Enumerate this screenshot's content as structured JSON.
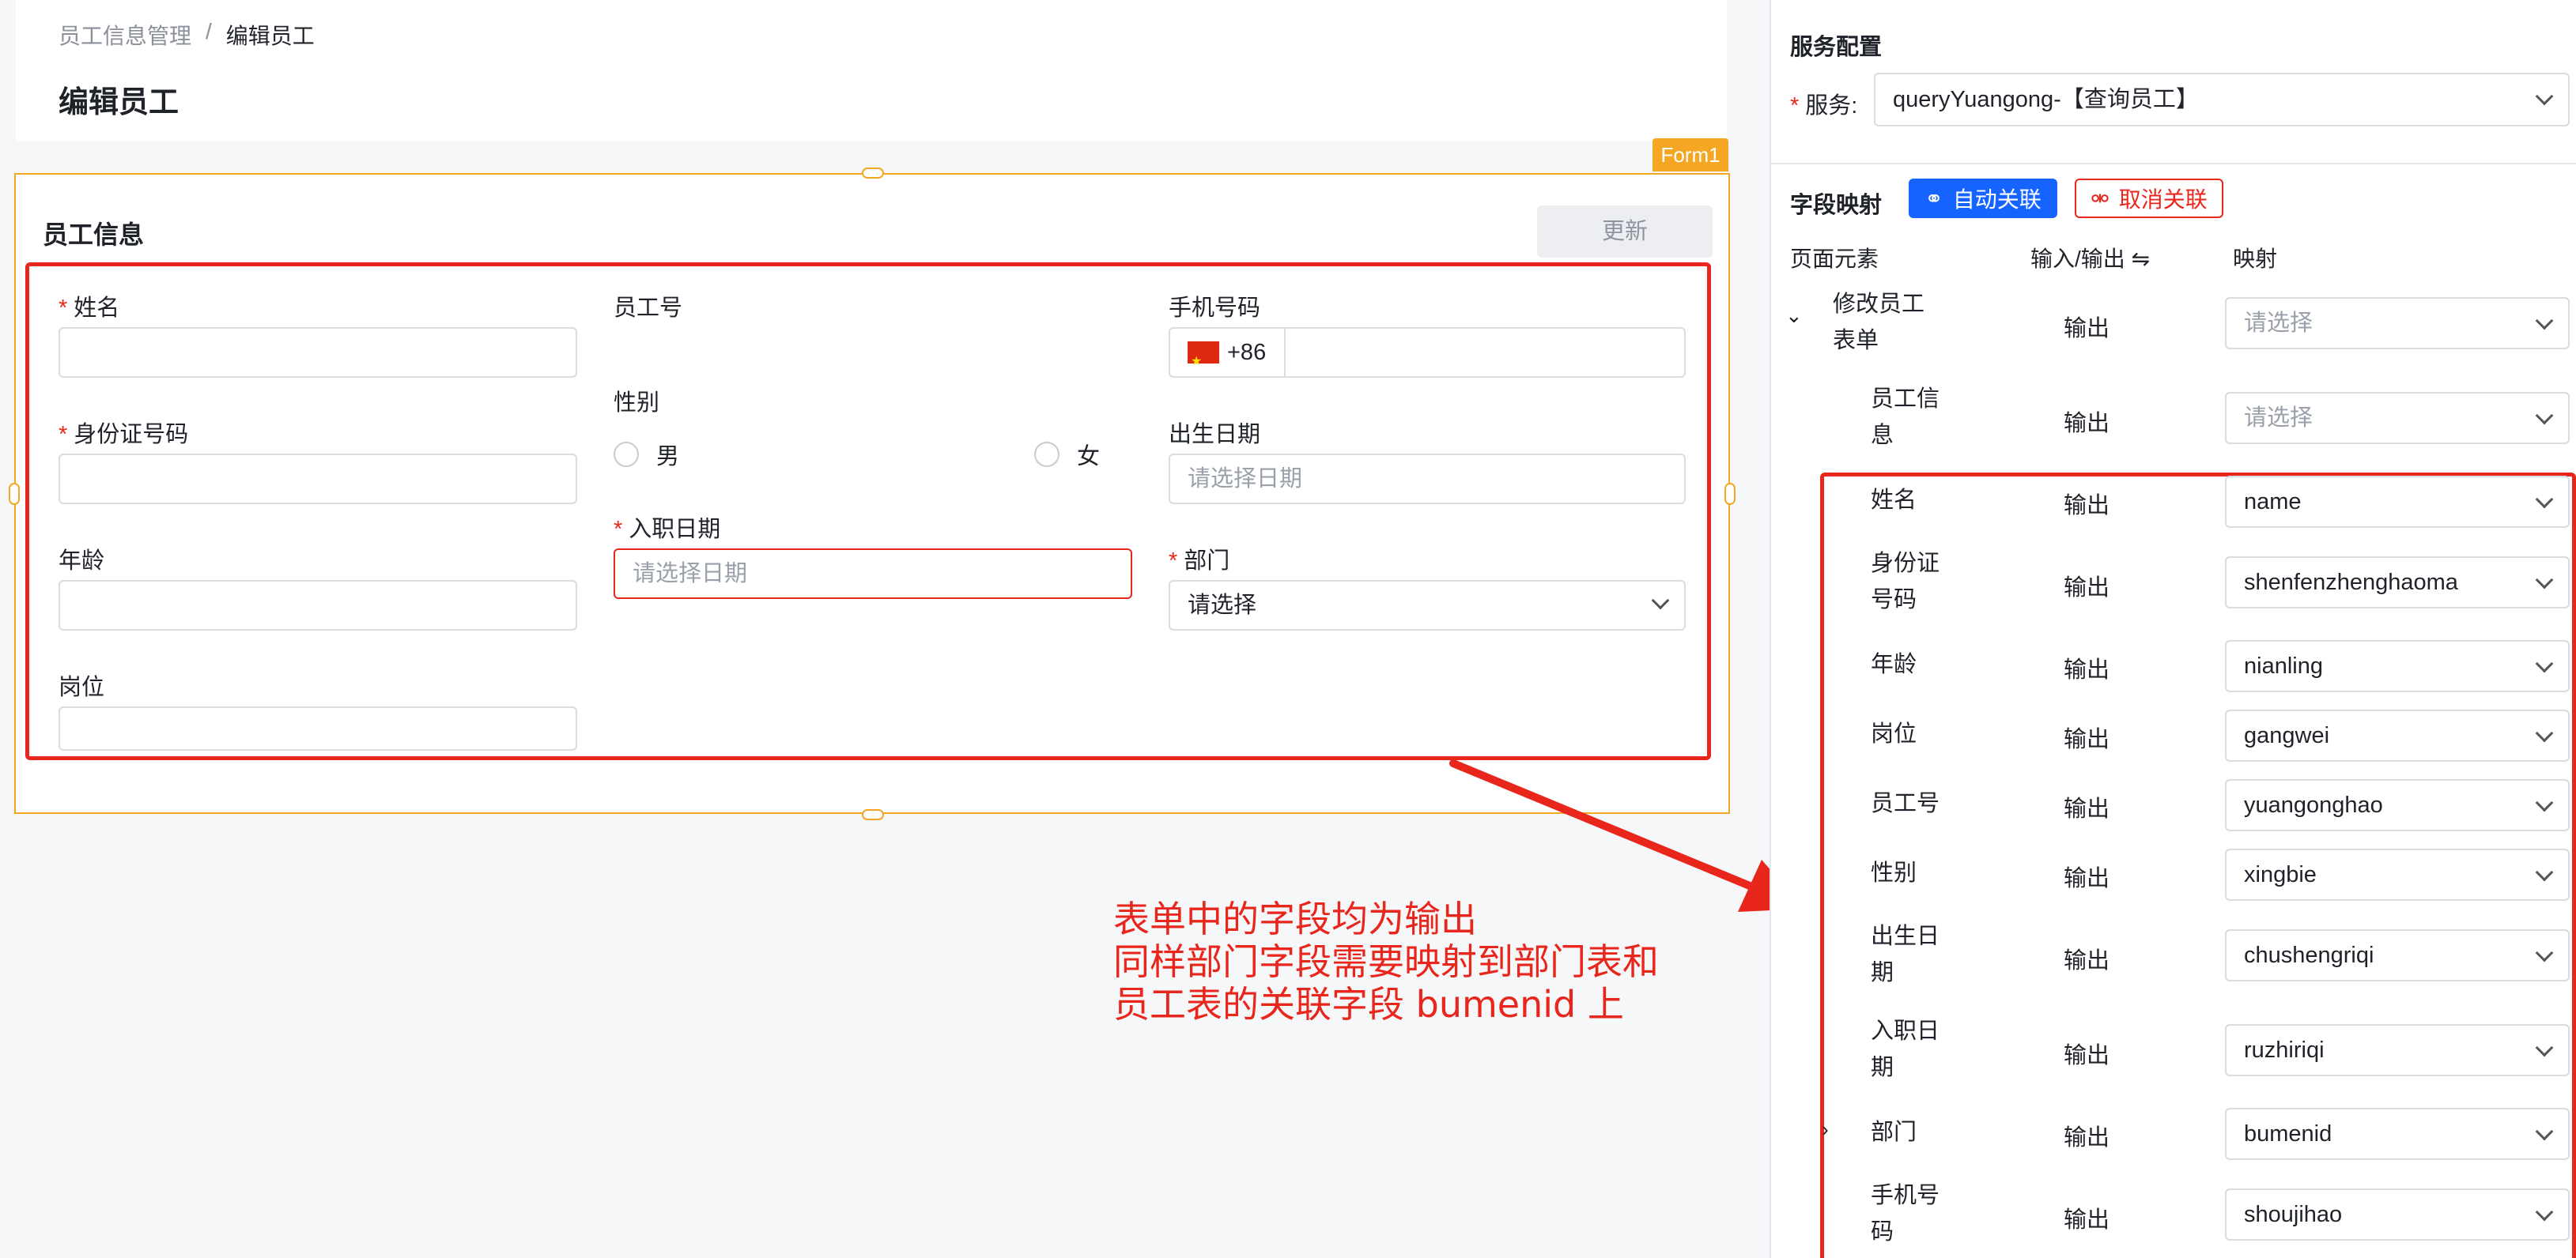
{
  "breadcrumb": {
    "parent": "员工信息管理",
    "separator": "/",
    "current": "编辑员工"
  },
  "page_title": "编辑员工",
  "form": {
    "tag": "Form1",
    "section_title": "员工信息",
    "update_label": "更新",
    "fields": {
      "name": {
        "label": "姓名",
        "required": "*"
      },
      "idcard": {
        "label": "身份证号码",
        "required": "*"
      },
      "age": {
        "label": "年龄"
      },
      "position": {
        "label": "岗位"
      },
      "empno": {
        "label": "员工号"
      },
      "gender": {
        "label": "性别",
        "option_male": "男",
        "option_female": "女"
      },
      "hiredate": {
        "label": "入职日期",
        "required": "*",
        "placeholder": "请选择日期"
      },
      "phone": {
        "label": "手机号码",
        "prefix": "+86"
      },
      "birthdate": {
        "label": "出生日期",
        "placeholder": "请选择日期"
      },
      "department": {
        "label": "部门",
        "required": "*",
        "placeholder": "请选择"
      }
    }
  },
  "annotation": {
    "line1": "表单中的字段均为输出",
    "line2": "同样部门字段需要映射到部门表和",
    "line3": "员工表的关联字段 bumenid 上"
  },
  "panel": {
    "service_config_title": "服务配置",
    "service_label": "服务:",
    "service_required": "*",
    "service_value": "queryYuangong-【查询员工】",
    "field_mapping_title": "字段映射",
    "auto_link_label": "自动关联",
    "cancel_link_label": "取消关联",
    "col_element": "页面元素",
    "col_io": "输入/输出 ⇋",
    "col_mapping": "映射",
    "rows": [
      {
        "name_l1": "修改员工",
        "name_l2": "表单",
        "io": "输出",
        "mapping": "请选择",
        "toggle": "⌄"
      },
      {
        "name_l1": "员工信",
        "name_l2": "息",
        "io": "输出",
        "mapping": "请选择"
      },
      {
        "name_l1": "姓名",
        "io": "输出",
        "mapping": "name"
      },
      {
        "name_l1": "身份证",
        "name_l2": "号码",
        "io": "输出",
        "mapping": "shenfenzhenghaoma"
      },
      {
        "name_l1": "年龄",
        "io": "输出",
        "mapping": "nianling"
      },
      {
        "name_l1": "岗位",
        "io": "输出",
        "mapping": "gangwei"
      },
      {
        "name_l1": "员工号",
        "io": "输出",
        "mapping": "yuangonghao"
      },
      {
        "name_l1": "性别",
        "io": "输出",
        "mapping": "xingbie"
      },
      {
        "name_l1": "出生日",
        "name_l2": "期",
        "io": "输出",
        "mapping": "chushengriqi"
      },
      {
        "name_l1": "入职日",
        "name_l2": "期",
        "io": "输出",
        "mapping": "ruzhiriqi"
      },
      {
        "name_l1": "部门",
        "io": "输出",
        "mapping": "bumenid",
        "toggle": "›"
      },
      {
        "name_l1": "手机号",
        "name_l2": "码",
        "io": "输出",
        "mapping": "shoujihao"
      }
    ]
  },
  "colors": {
    "accent": "#1664ff",
    "danger": "#e8261b",
    "frame": "#f5a623"
  }
}
